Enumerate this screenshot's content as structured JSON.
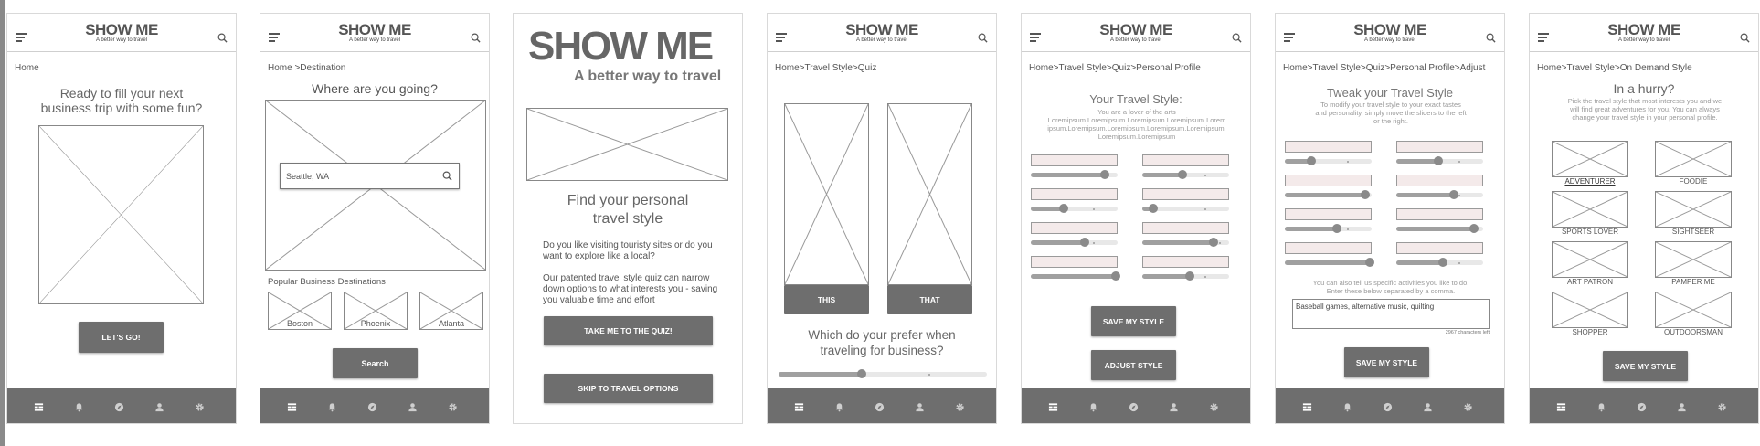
{
  "common": {
    "logo": "SHOW ME",
    "tagline": "A better way to travel"
  },
  "s1": {
    "crumb": "Home",
    "heading": [
      "Ready to fill your next",
      "business trip with some fun?"
    ],
    "button": "LET'S GO!"
  },
  "s2": {
    "crumb": "Home >Destination",
    "heading": "Where are you going?",
    "search_value": "Seattle, WA",
    "popular_label": "Popular Business Destinations",
    "cities": [
      "Boston",
      "Phoenix",
      "Atlanta"
    ],
    "button": "Search"
  },
  "s3": {
    "logo": "SHOW ME",
    "tagline": "A better way to travel",
    "heading": [
      "Find your personal",
      "travel style"
    ],
    "para1": "Do you like visiting touristy sites or do you want to explore like a local?",
    "para2": "Our patented travel style quiz can narrow down options to what interests you - saving you valuable time and effort",
    "button1": "TAKE ME TO THE QUIZ!",
    "button2": "SKIP TO TRAVEL OPTIONS"
  },
  "s4": {
    "crumb": "Home>Travel Style>Quiz",
    "this_label": "THIS",
    "that_label": "THAT",
    "question": [
      "Which do your prefer when",
      "traveling for business?"
    ],
    "progress": 0.4
  },
  "s5": {
    "crumb": "Home>Travel Style>Quiz>Personal Profile",
    "heading": "Your Travel Style:",
    "blurb": [
      "You are a lover of the arts",
      "Loremipsum.Loremipsum.Loremipsum.Loremipsum.Lorem",
      "ipsum.Loremipsum.Loremipsum.Loremipsum.Loremipsum.",
      "Loremipsum.Loremipsum"
    ],
    "sliders_left": [
      0.85,
      0.38,
      0.62,
      0.98
    ],
    "sliders_right": [
      0.46,
      0.13,
      0.82,
      0.55
    ],
    "button1": "SAVE MY STYLE",
    "button2": "ADJUST STYLE"
  },
  "s6": {
    "crumb": "Home>Travel Style>Quiz>Personal Profile>Adjust",
    "heading": "Tweak your Travel Style",
    "blurb": [
      "To modify your travel style to your exact tastes",
      "and personality, simply move the sliders to the left",
      "or the right."
    ],
    "sliders_left": [
      0.3,
      0.93,
      0.6,
      0.98
    ],
    "sliders_right": [
      0.48,
      0.66,
      0.89,
      0.54
    ],
    "activities_hint": [
      "You can also tell us specific activities you like to do.",
      "Enter these below separated by a comma."
    ],
    "activities_value": "Baseball games, alternative music, quilting",
    "char_count": "2967 characters left",
    "button": "SAVE MY STYLE"
  },
  "s7": {
    "crumb": "Home>Travel Style>On Demand Style",
    "heading": "In a hurry?",
    "blurb": [
      "Pick the travel style that most interests you and we",
      "will find great adventures for you. You can always",
      "change your travel style in your personal profile."
    ],
    "styles": [
      "ADVENTURER",
      "FOODIE",
      "SPORTS LOVER",
      "SIGHTSEER",
      "ART PATRON",
      "PAMPER ME",
      "SHOPPER",
      "OUTDOORSMAN"
    ],
    "button": "SAVE MY STYLE"
  },
  "nav_icons": [
    "dashboard-icon",
    "bell-icon",
    "compass-icon",
    "user-icon",
    "gear-icon"
  ]
}
